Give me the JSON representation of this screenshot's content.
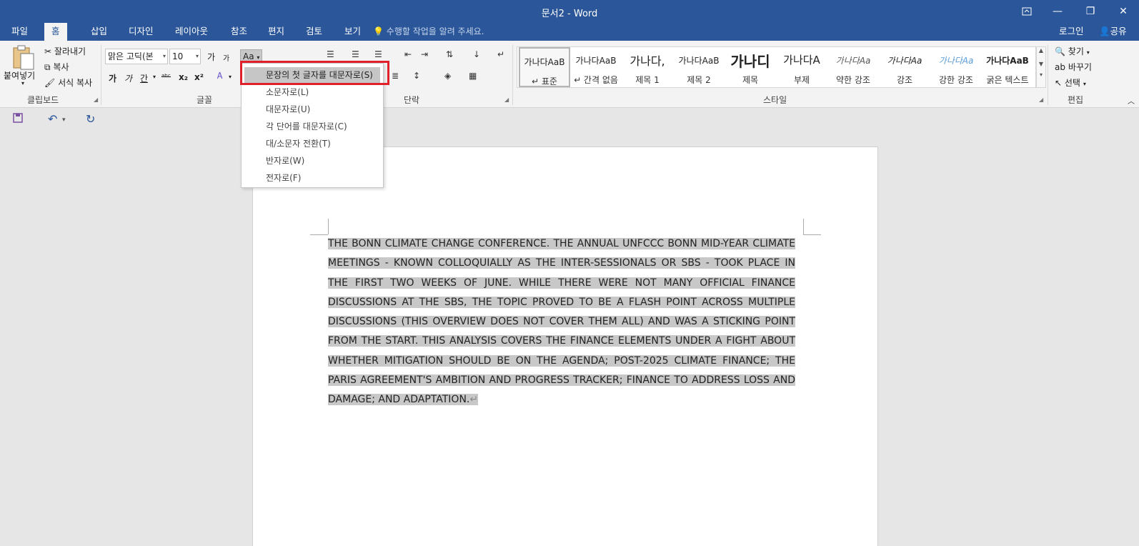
{
  "window": {
    "title": "문서2 - Word",
    "ribbon_display_icon": "ribbon-display-icon",
    "minimize": "—",
    "restore": "❐",
    "close": "✕"
  },
  "tabs": [
    "파일",
    "홈",
    "삽입",
    "디자인",
    "레이아웃",
    "참조",
    "편지",
    "검토",
    "보기"
  ],
  "tell_me": "수행할 작업을 알려 주세요.",
  "account": {
    "login": "로그인",
    "share": "공유"
  },
  "clipboard": {
    "paste": "붙여넣기",
    "cut": "잘라내기",
    "copy": "복사",
    "format_painter": "서식 복사",
    "label": "클립보드"
  },
  "font": {
    "name": "맑은 고딕(본",
    "size": "10",
    "label": "글꼴",
    "bold": "가",
    "italic": "가",
    "underline": "간",
    "strike": "ᵃᵇᶜ",
    "sub": "x₂",
    "sup": "x²",
    "grow": "가",
    "shrink": "가",
    "change_case": "Aa"
  },
  "paragraph": {
    "label": "단락"
  },
  "styles": {
    "label": "스타일",
    "items": [
      {
        "sample": "가나다AaB",
        "name": "↵ 표준"
      },
      {
        "sample": "가나다AaB",
        "name": "↵ 간격 없음"
      },
      {
        "sample": "가나다,",
        "name": "제목 1"
      },
      {
        "sample": "가나다AaB",
        "name": "제목 2"
      },
      {
        "sample": "가나디",
        "name": "제목"
      },
      {
        "sample": "가나다A",
        "name": "부제"
      },
      {
        "sample": "가나다Aa",
        "name": "약한 강조"
      },
      {
        "sample": "가나다Aa",
        "name": "강조"
      },
      {
        "sample": "가나다Aa",
        "name": "강한 강조"
      },
      {
        "sample": "가나다AaB",
        "name": "굵은 텍스트"
      }
    ]
  },
  "editing": {
    "find": "찾기",
    "replace": "바꾸기",
    "select": "선택",
    "label": "편집"
  },
  "change_case_menu": [
    "문장의 첫 글자를 대문자로(S)",
    "소문자로(L)",
    "대문자로(U)",
    "각 단어를 대문자로(C)",
    "대/소문자 전환(T)",
    "반자로(W)",
    "전자로(F)"
  ],
  "document": {
    "text": "THE BONN CLIMATE CHANGE CONFERENCE. THE ANNUAL UNFCCC BONN MID-YEAR CLIMATE MEETINGS - KNOWN COLLOQUIALLY AS THE INTER-SESSIONALS OR SBS - TOOK PLACE IN THE FIRST TWO WEEKS OF JUNE. WHILE THERE WERE NOT MANY OFFICIAL FINANCE DISCUSSIONS AT THE SBS, THE TOPIC PROVED TO BE A FLASH POINT ACROSS MULTIPLE DISCUSSIONS (THIS OVERVIEW DOES NOT COVER THEM ALL) AND WAS A STICKING POINT FROM THE START. THIS ANALYSIS COVERS THE FINANCE ELEMENTS UNDER A FIGHT ABOUT WHETHER MITIGATION SHOULD BE ON THE AGENDA; POST-2025 CLIMATE FINANCE; THE PARIS AGREEMENT'S AMBITION AND PROGRESS TRACKER; FINANCE TO ADDRESS LOSS AND DAMAGE; AND ADAPTATION.",
    "para_mark": "↵"
  },
  "colors": {
    "brand": "#2b579a",
    "highlight": "#e0202a"
  }
}
